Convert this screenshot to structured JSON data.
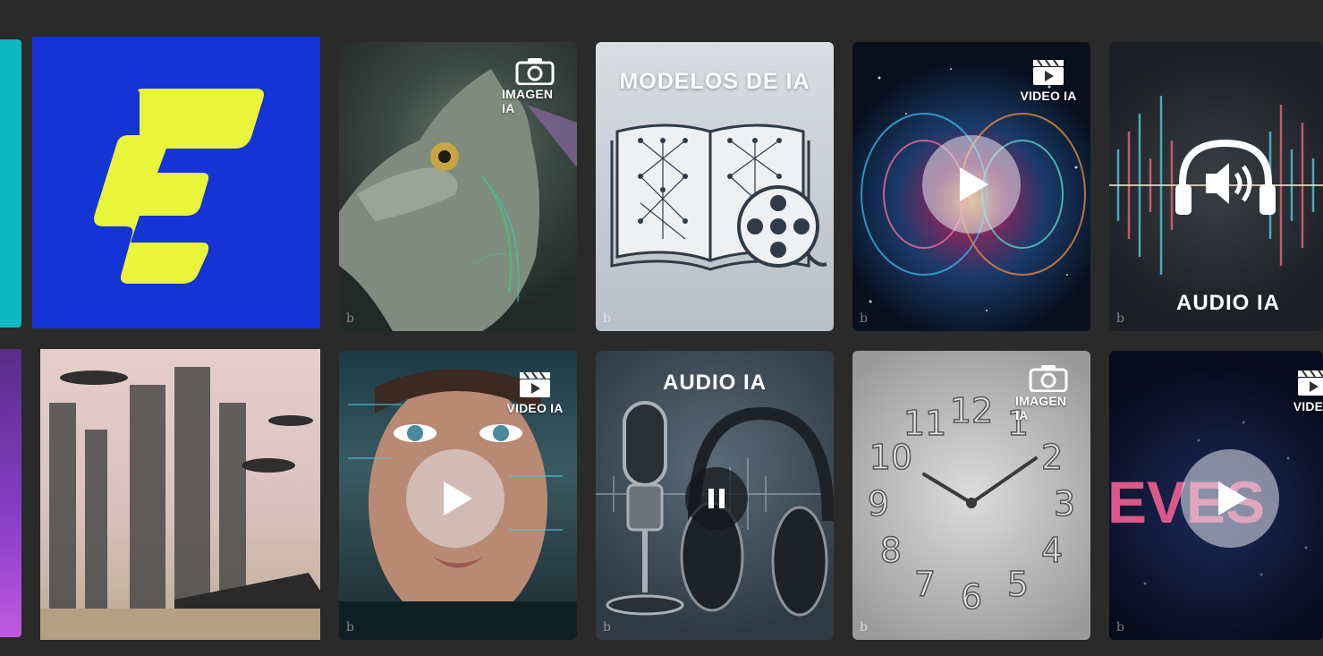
{
  "tiles": {
    "logo": {
      "colors": {
        "bg": "#1434d6",
        "mark": "#e8f53a",
        "edge": "#0eb7c2"
      }
    },
    "dragon": {
      "badge": "IMAGEN IA",
      "icon": "camera-icon",
      "watermark": "b"
    },
    "modelos": {
      "title": "MODELOS DE IA",
      "icon": "book-film-icon",
      "watermark": "b"
    },
    "cosmos": {
      "badge": "VIDEO IA",
      "icon": "clapper-icon",
      "watermark": "b"
    },
    "audio_wave": {
      "title": "AUDIO IA",
      "icon": "headphones-speaker-icon",
      "watermark": "b"
    },
    "city": {},
    "face": {
      "badge": "VIDEO IA",
      "icon": "clapper-icon",
      "watermark": "b"
    },
    "mic": {
      "title": "AUDIO IA",
      "icon": "microphone-headphones-icon",
      "watermark": "b"
    },
    "clock": {
      "badge": "IMAGEN IA",
      "icon": "camera-icon",
      "watermark": "b",
      "numbers": [
        "12",
        "1",
        "2",
        "3",
        "4",
        "5",
        "6",
        "7",
        "8",
        "9",
        "10",
        "11"
      ]
    },
    "words": {
      "badge": "VIDEO",
      "icon": "clapper-icon",
      "watermark": "b",
      "art_text": "EVES"
    }
  }
}
